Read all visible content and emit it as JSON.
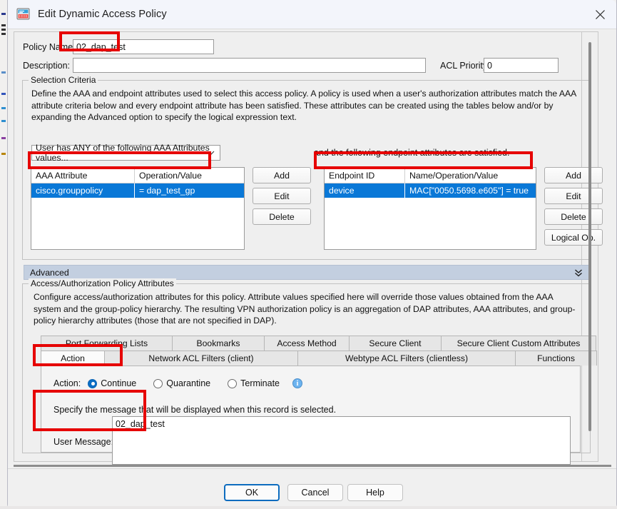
{
  "window": {
    "title": "Edit Dynamic Access Policy",
    "icon": "app-policy-icon",
    "close_label": "✕"
  },
  "form": {
    "policy_name_label": "Policy Name",
    "policy_name_value": "02_dap_test",
    "description_label": "Description:",
    "description_value": "",
    "acl_priority_label": "ACL Priority:",
    "acl_priority_value": "0"
  },
  "selection_criteria": {
    "legend": "Selection Criteria",
    "description": "Define the AAA and endpoint attributes used to select this access policy. A policy is used when a user's authorization attributes match the AAA attribute criteria below and every endpoint attribute has been satisfied. These attributes can be created using the tables below and/or by expanding the Advanced option to specify the logical expression text.",
    "aaa_selector_value": "User has ANY of the following AAA Attributes values...",
    "endpoint_note": "and the following endpoint attributes are satisfied.",
    "aaa_table": {
      "columns": [
        "AAA Attribute",
        "Operation/Value"
      ],
      "rows": [
        {
          "attribute": "cisco.grouppolicy",
          "operation_value": "=   dap_test_gp",
          "selected": true
        }
      ]
    },
    "aaa_buttons": [
      "Add",
      "Edit",
      "Delete"
    ],
    "endpoint_table": {
      "columns": [
        "Endpoint ID",
        "Name/Operation/Value"
      ],
      "rows": [
        {
          "endpoint_id": "device",
          "name_operation_value": "MAC[\"0050.5698.e605\"]  =  true",
          "selected": true
        }
      ]
    },
    "endpoint_buttons": [
      "Add",
      "Edit",
      "Delete",
      "Logical Op."
    ],
    "advanced_label": "Advanced",
    "advanced_chevron": "»"
  },
  "policy_attributes": {
    "legend": "Access/Authorization Policy Attributes",
    "description": "Configure access/authorization attributes for this policy. Attribute values specified here will override those values obtained from the AAA system and the group-policy hierarchy. The resulting VPN authorization policy is an aggregation of DAP attributes, AAA attributes, and group-policy hierarchy attributes (those that are not specified in DAP).",
    "tabs_top": [
      "Port Forwarding Lists",
      "Bookmarks",
      "Access Method",
      "Secure Client",
      "Secure Client Custom Attributes"
    ],
    "tabs_bottom": [
      "Action",
      "Network ACL Filters (client)",
      "Webtype ACL Filters (clientless)",
      "Functions"
    ],
    "selected_tab": "Action",
    "action": {
      "label": "Action:",
      "options": [
        "Continue",
        "Quarantine",
        "Terminate"
      ],
      "selected": "Continue",
      "info_glyph": "i"
    },
    "user_message": {
      "instruction": "Specify the message that will be displayed when this record is selected.",
      "label": "User Message:",
      "value": "02_dap_test"
    }
  },
  "footer": {
    "ok_label": "OK",
    "cancel_label": "Cancel",
    "help_label": "Help"
  },
  "colors": {
    "selection_blue": "#0a78d7",
    "annotation_red": "#e60000",
    "advanced_bar": "#c3cfe0",
    "focus_blue": "#0d6cbf"
  }
}
